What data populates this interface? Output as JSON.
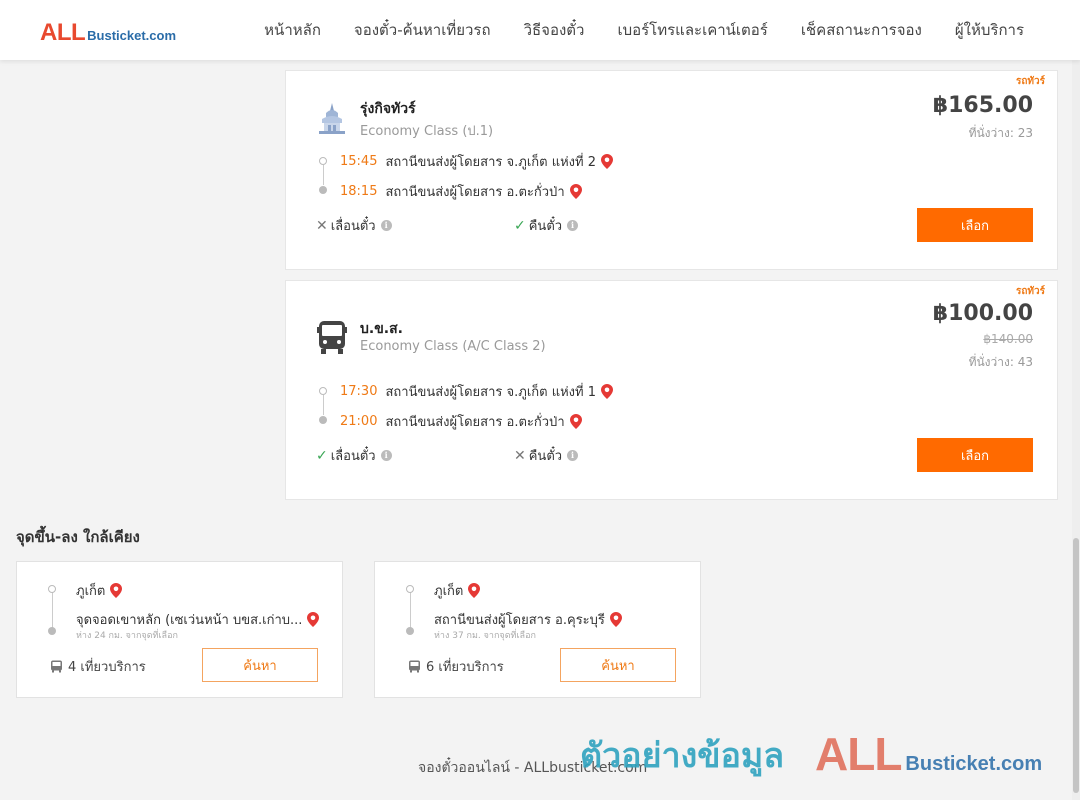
{
  "header": {
    "logo_primary": "ALL",
    "logo_secondary": "Busticket.com",
    "nav": [
      "หน้าหลัก",
      "จองตั๋ว-ค้นหาเที่ยวรถ",
      "วิธีจองตั๋ว",
      "เบอร์โทรและเคาน์เตอร์",
      "เช็คสถานะการจอง",
      "ผู้ให้บริการ"
    ]
  },
  "trips": [
    {
      "tag": "รถทัวร์",
      "operator": "รุ่งกิจทัวร์",
      "class": "Economy Class (ป.1)",
      "price": "฿165.00",
      "seats": "ที่นั่งว่าง: 23",
      "departure_time": "15:45",
      "departure_place": "สถานีขนส่งผู้โดยสาร จ.ภูเก็ต แห่งที่ 2",
      "arrival_time": "18:15",
      "arrival_place": "สถานีขนส่งผู้โดยสาร อ.ตะกั่วป่า",
      "reschedule_label": "เลื่อนตั๋ว",
      "reschedule_allowed": false,
      "refund_label": "คืนตั๋ว",
      "refund_allowed": true,
      "select_label": "เลือก",
      "icon": "temple-icon"
    },
    {
      "tag": "รถทัวร์",
      "operator": "บ.ข.ส.",
      "class": "Economy Class (A/C Class 2)",
      "price": "฿100.00",
      "old_price": "฿140.00",
      "seats": "ที่นั่งว่าง: 43",
      "departure_time": "17:30",
      "departure_place": "สถานีขนส่งผู้โดยสาร จ.ภูเก็ต แห่งที่ 1",
      "arrival_time": "21:00",
      "arrival_place": "สถานีขนส่งผู้โดยสาร อ.ตะกั่วป่า",
      "reschedule_label": "เลื่อนตั๋ว",
      "reschedule_allowed": true,
      "refund_label": "คืนตั๋ว",
      "refund_allowed": false,
      "select_label": "เลือก",
      "icon": "bus-icon"
    }
  ],
  "nearby": {
    "title": "จุดขึ้น-ลง ใกล้เคียง",
    "items": [
      {
        "from": "ภูเก็ต",
        "to": "จุดจอดเขาหลัก (เซเว่นหน้า บขส.เก่าบ...",
        "distance": "ห่าง 24 กม. จากจุดที่เลือก",
        "trips": "4 เที่ยวบริการ",
        "search_label": "ค้นหา"
      },
      {
        "from": "ภูเก็ต",
        "to": "สถานีขนส่งผู้โดยสาร อ.คุระบุรี",
        "distance": "ห่าง 37 กม. จากจุดที่เลือก",
        "trips": "6 เที่ยวบริการ",
        "search_label": "ค้นหา"
      }
    ]
  },
  "footer": {
    "text": "จองตั๋วออนไลน์ - ALLbusticket.com"
  },
  "watermark": {
    "text": "ตัวอย่างข้อมูล",
    "logo_primary": "ALL",
    "logo_secondary": "Busticket.com"
  },
  "colors": {
    "accent": "#ff6a00",
    "time": "#ef7a16",
    "pin": "#e53935",
    "check": "#3aa655"
  }
}
